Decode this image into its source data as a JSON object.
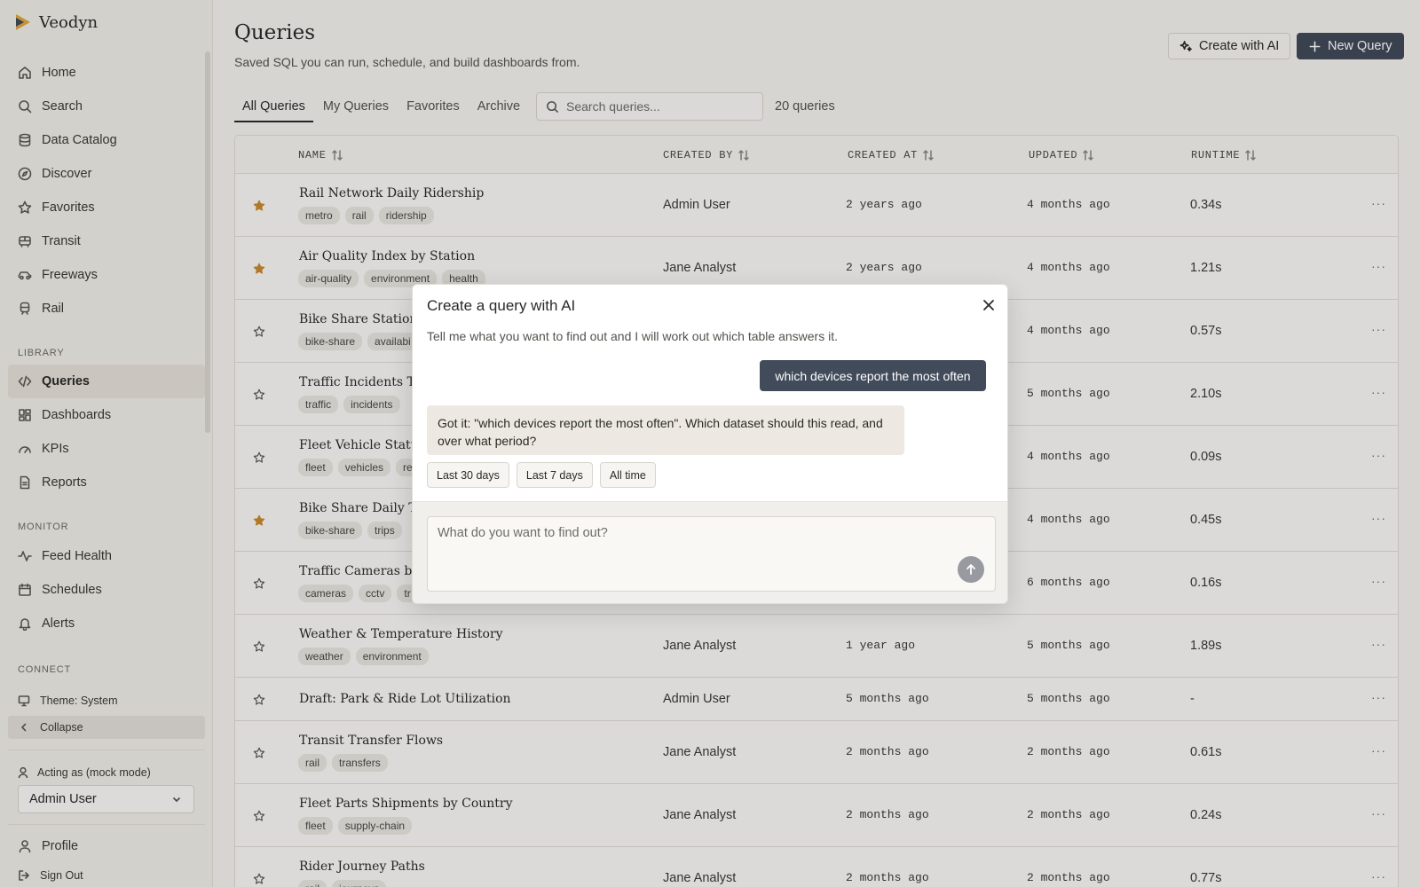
{
  "app": {
    "name": "Veodyn"
  },
  "sidebar": {
    "primary": [
      {
        "label": "Home",
        "icon": "home-icon"
      },
      {
        "label": "Search",
        "icon": "search-icon"
      },
      {
        "label": "Data Catalog",
        "icon": "database-icon"
      },
      {
        "label": "Discover",
        "icon": "compass-icon"
      },
      {
        "label": "Favorites",
        "icon": "star-icon"
      },
      {
        "label": "Transit",
        "icon": "bus-icon"
      },
      {
        "label": "Freeways",
        "icon": "car-icon"
      },
      {
        "label": "Rail",
        "icon": "train-icon"
      }
    ],
    "library_title": "LIBRARY",
    "library": [
      {
        "label": "Queries",
        "icon": "code-icon",
        "active": true
      },
      {
        "label": "Dashboards",
        "icon": "dashboard-icon"
      },
      {
        "label": "KPIs",
        "icon": "gauge-icon"
      },
      {
        "label": "Reports",
        "icon": "report-icon"
      }
    ],
    "monitor_title": "MONITOR",
    "monitor": [
      {
        "label": "Feed Health",
        "icon": "activity-icon"
      },
      {
        "label": "Schedules",
        "icon": "calendar-icon"
      },
      {
        "label": "Alerts",
        "icon": "bell-icon"
      }
    ],
    "connect_title": "CONNECT",
    "theme_label": "Theme: System",
    "collapse_label": "Collapse",
    "acting_label": "Acting as (mock mode)",
    "acting_user": "Admin User",
    "profile_label": "Profile",
    "signout_label": "Sign Out"
  },
  "header": {
    "title": "Queries",
    "subtitle": "Saved SQL you can run, schedule, and build dashboards from.",
    "create_ai_label": "Create with AI",
    "new_query_label": "New Query"
  },
  "tabs": [
    "All Queries",
    "My Queries",
    "Favorites",
    "Archive"
  ],
  "search": {
    "placeholder": "Search queries..."
  },
  "count_label": "20 queries",
  "table": {
    "columns": [
      "NAME",
      "CREATED BY",
      "CREATED AT",
      "UPDATED",
      "RUNTIME"
    ],
    "rows": [
      {
        "name": "Rail Network Daily Ridership",
        "tags": [
          "metro",
          "rail",
          "ridership"
        ],
        "created_by": "Admin User",
        "created_at": "2 years ago",
        "updated": "4 months ago",
        "runtime": "0.34s",
        "favorite": true
      },
      {
        "name": "Air Quality Index by Station",
        "tags": [
          "air-quality",
          "environment",
          "health"
        ],
        "created_by": "Jane Analyst",
        "created_at": "2 years ago",
        "updated": "4 months ago",
        "runtime": "1.21s",
        "favorite": true
      },
      {
        "name": "Bike Share Station Av",
        "tags": [
          "bike-share",
          "availabi"
        ],
        "created_by": "",
        "created_at": "",
        "updated": "4 months ago",
        "runtime": "0.57s",
        "favorite": false
      },
      {
        "name": "Traffic Incidents This",
        "tags": [
          "traffic",
          "incidents"
        ],
        "created_by": "",
        "created_at": "",
        "updated": "5 months ago",
        "runtime": "2.10s",
        "favorite": false
      },
      {
        "name": "Fleet Vehicle Status S",
        "tags": [
          "fleet",
          "vehicles",
          "re"
        ],
        "created_by": "",
        "created_at": "",
        "updated": "4 months ago",
        "runtime": "0.09s",
        "favorite": false
      },
      {
        "name": "Bike Share Daily Trip",
        "tags": [
          "bike-share",
          "trips"
        ],
        "created_by": "",
        "created_at": "",
        "updated": "4 months ago",
        "runtime": "0.45s",
        "favorite": true
      },
      {
        "name": "Traffic Cameras by C",
        "tags": [
          "cameras",
          "cctv",
          "tr"
        ],
        "created_by": "",
        "created_at": "",
        "updated": "6 months ago",
        "runtime": "0.16s",
        "favorite": false
      },
      {
        "name": "Weather & Temperature History",
        "tags": [
          "weather",
          "environment"
        ],
        "created_by": "Jane Analyst",
        "created_at": "1 year ago",
        "updated": "5 months ago",
        "runtime": "1.89s",
        "favorite": false
      },
      {
        "name": "Draft: Park & Ride Lot Utilization",
        "tags": [],
        "created_by": "Admin User",
        "created_at": "5 months ago",
        "updated": "5 months ago",
        "runtime": "-",
        "favorite": false
      },
      {
        "name": "Transit Transfer Flows",
        "tags": [
          "rail",
          "transfers"
        ],
        "created_by": "Jane Analyst",
        "created_at": "2 months ago",
        "updated": "2 months ago",
        "runtime": "0.61s",
        "favorite": false
      },
      {
        "name": "Fleet Parts Shipments by Country",
        "tags": [
          "fleet",
          "supply-chain"
        ],
        "created_by": "Jane Analyst",
        "created_at": "2 months ago",
        "updated": "2 months ago",
        "runtime": "0.24s",
        "favorite": false
      },
      {
        "name": "Rider Journey Paths",
        "tags": [
          "rail",
          "journeys"
        ],
        "created_by": "Jane Analyst",
        "created_at": "2 months ago",
        "updated": "2 months ago",
        "runtime": "0.77s",
        "favorite": false
      }
    ]
  },
  "modal": {
    "title": "Create a query with AI",
    "description": "Tell me what you want to find out and I will work out which table answers it.",
    "user_message": "which devices report the most often",
    "ai_message": "Got it: \"which devices report the most often\". Which dataset should this read, and over what period?",
    "options": [
      "Last 30 days",
      "Last 7 days",
      "All time"
    ],
    "input_placeholder": "What do you want to find out?"
  },
  "colors": {
    "accent": "#414b5a",
    "star_filled": "#c98a2e",
    "background": "#f5f3ef"
  }
}
